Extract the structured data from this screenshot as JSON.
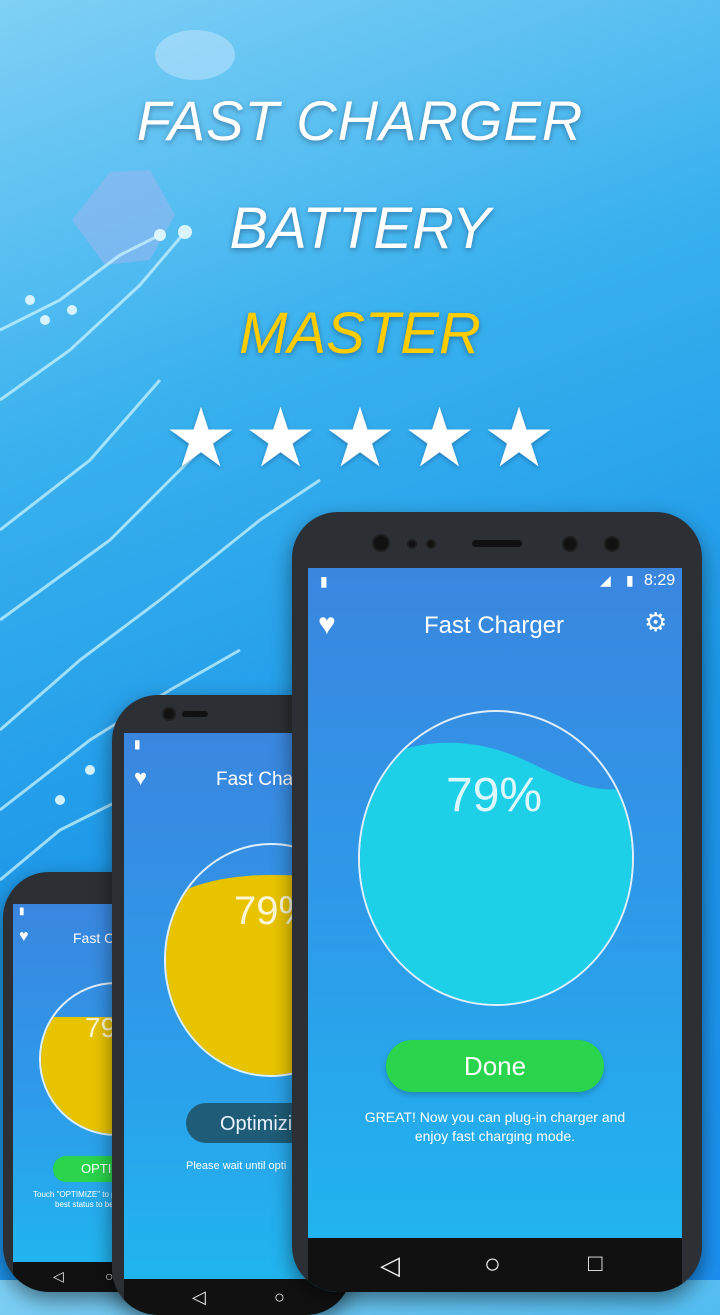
{
  "promo": {
    "line1": "FAST CHARGER",
    "line2": "BATTERY",
    "line3": "MASTER",
    "rating_stars": 5,
    "star_glyph": "★"
  },
  "phone_main": {
    "status_time": "8:29",
    "app_title": "Fast Charger",
    "battery_percent": "79%",
    "done_label": "Done",
    "message_line1": "GREAT! Now you can plug-in charger and",
    "message_line2": "enjoy fast charging mode.",
    "wave_color": "#1ecfe8"
  },
  "phone_mid": {
    "app_title": "Fast Cha",
    "battery_percent": "79%",
    "optimize_label": "Optimizi",
    "wait_text": "Please wait until opti",
    "fill_color": "#e8c400"
  },
  "phone_small": {
    "app_title": "Fast Ch",
    "battery_percent": "79",
    "optimize_label": "OPTIM",
    "hint_line1": "Touch \"OPTIMIZE\" to p",
    "hint_line2": "best status to be",
    "fill_color": "#e8c400"
  },
  "colors": {
    "accent_green": "#2ad44c",
    "accent_yellow": "#ffcc00"
  }
}
